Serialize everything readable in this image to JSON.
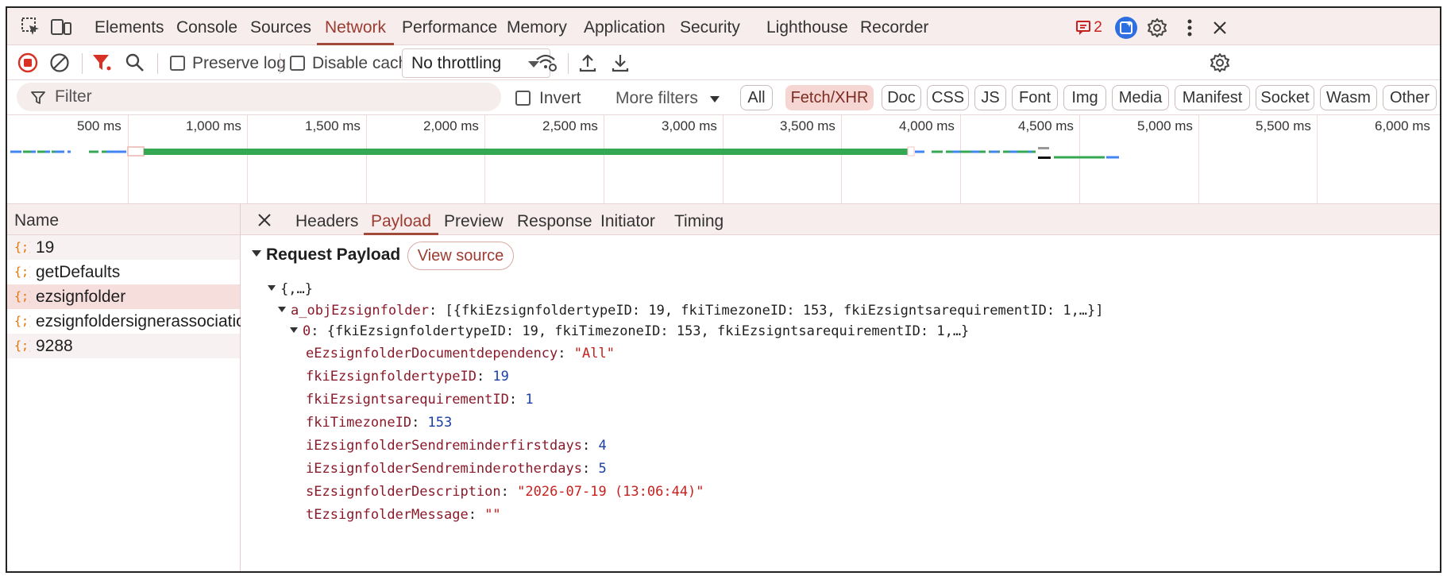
{
  "top_tabs": [
    "Elements",
    "Console",
    "Sources",
    "Network",
    "Performance",
    "Memory",
    "Application",
    "Security",
    "Lighthouse",
    "Recorder"
  ],
  "active_tab": "Network",
  "issues_count": "2",
  "toolbar": {
    "preserve_log": "Preserve log",
    "disable_cache": "Disable cache",
    "throttling": "No throttling"
  },
  "filter": {
    "placeholder": "Filter",
    "invert": "Invert",
    "more_filters": "More filters",
    "types": [
      "All",
      "Fetch/XHR",
      "Doc",
      "CSS",
      "JS",
      "Font",
      "Img",
      "Media",
      "Manifest",
      "Socket",
      "Wasm",
      "Other"
    ],
    "active_type": "Fetch/XHR"
  },
  "overview": {
    "ticks": [
      "500 ms",
      "1,000 ms",
      "1,500 ms",
      "2,000 ms",
      "2,500 ms",
      "3,000 ms",
      "3,500 ms",
      "4,000 ms",
      "4,500 ms",
      "5,000 ms",
      "5,500 ms",
      "6,000 ms"
    ]
  },
  "requests": {
    "header": "Name",
    "items": [
      "19",
      "getDefaults",
      "ezsignfolder",
      "ezsignfoldersignerassociation",
      "9288"
    ],
    "selected": "ezsignfolder"
  },
  "detail": {
    "tabs": [
      "Headers",
      "Payload",
      "Preview",
      "Response",
      "Initiator",
      "Timing"
    ],
    "active_tab": "Payload",
    "section_title": "Request Payload",
    "view_source": "View source",
    "root": "{,…}",
    "array_key": "a_objEzsignfolder",
    "array_preview": "[{fkiEzsignfoldertypeID: 19, fkiTimezoneID: 153, fkiEzsigntsarequirementID: 1,…}]",
    "item_key": "0",
    "item_preview": "{fkiEzsignfoldertypeID: 19, fkiTimezoneID: 153, fkiEzsigntsarequirementID: 1,…}",
    "fields": [
      {
        "key": "eEzsignfolderDocumentdependency",
        "value": "\"All\"",
        "type": "string"
      },
      {
        "key": "fkiEzsignfoldertypeID",
        "value": "19",
        "type": "number"
      },
      {
        "key": "fkiEzsigntsarequirementID",
        "value": "1",
        "type": "number"
      },
      {
        "key": "fkiTimezoneID",
        "value": "153",
        "type": "number"
      },
      {
        "key": "iEzsignfolderSendreminderfirstdays",
        "value": "4",
        "type": "number"
      },
      {
        "key": "iEzsignfolderSendreminderotherdays",
        "value": "5",
        "type": "number"
      },
      {
        "key": "sEzsignfolderDescription",
        "value": "\"2026-07-19 (13:06:44)\"",
        "type": "string"
      },
      {
        "key": "tEzsignfolderMessage",
        "value": "\"\"",
        "type": "string"
      }
    ]
  },
  "colors": {
    "accent": "#a14a3a",
    "fetch_active_bg": "#f6d6d3",
    "green_bar": "#34a853",
    "blue_bar": "#4285f4",
    "string": "#c5221f",
    "number": "#1a3fa6",
    "key": "#8a1a2a"
  }
}
